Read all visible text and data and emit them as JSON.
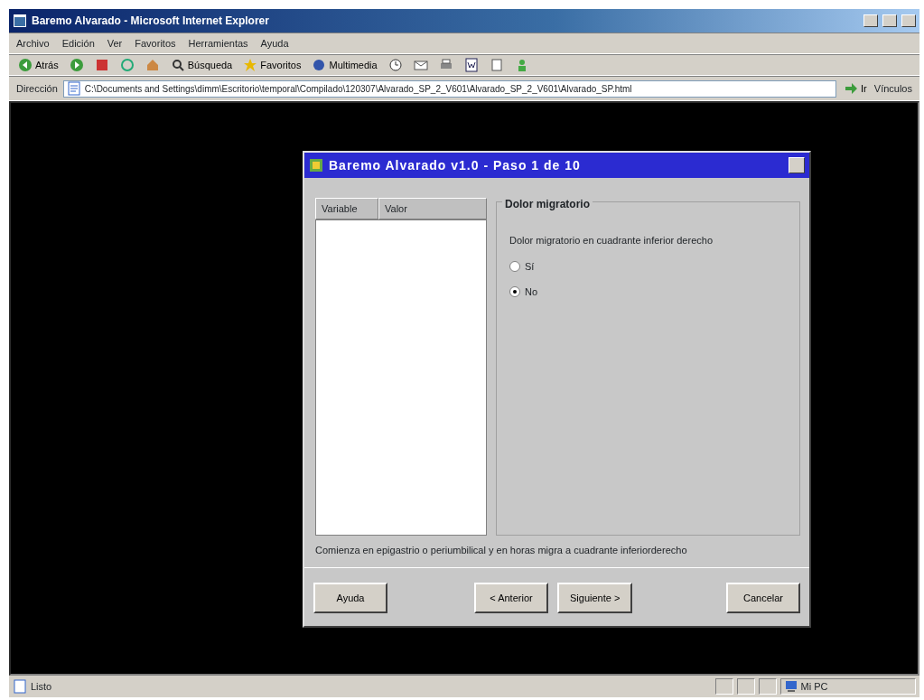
{
  "window": {
    "title": "Baremo Alvarado - Microsoft Internet Explorer"
  },
  "menu": [
    "Archivo",
    "Edición",
    "Ver",
    "Favoritos",
    "Herramientas",
    "Ayuda"
  ],
  "toolbar": [
    {
      "kind": "back",
      "label": "Atrás"
    },
    {
      "kind": "forward"
    },
    {
      "kind": "stop"
    },
    {
      "kind": "refresh"
    },
    {
      "kind": "home"
    },
    {
      "kind": "search",
      "label": "Búsqueda"
    },
    {
      "kind": "favorites",
      "label": "Favoritos"
    },
    {
      "kind": "media",
      "label": "Multimedia"
    },
    {
      "kind": "history"
    },
    {
      "kind": "mail"
    },
    {
      "kind": "print"
    },
    {
      "kind": "word"
    },
    {
      "kind": "edit"
    },
    {
      "kind": "messenger"
    }
  ],
  "address": {
    "label": "Dirección",
    "value": "C:\\Documents and Settings\\dimm\\Escritorio\\temporal\\Compilado\\120307\\Alvarado_SP_2_V601\\Alvarado_SP_2_V601\\Alvarado_SP.html",
    "go": "Ir",
    "links": "Vínculos"
  },
  "dialog": {
    "title": "Baremo Alvarado v1.0 - Paso 1 de 10",
    "table": {
      "columns": [
        "Variable",
        "Valor"
      ]
    },
    "group": {
      "title": "Dolor migratorio",
      "question": "Dolor migratorio en cuadrante inferior derecho",
      "options": [
        {
          "label": "Sí",
          "selected": false
        },
        {
          "label": "No",
          "selected": true
        }
      ]
    },
    "hint": "Comienza en epigastrio o periumbilical y en horas migra a cuadrante inferiorderecho",
    "buttons": [
      "Ayuda",
      "< Anterior",
      "Siguiente >",
      "Cancelar"
    ]
  },
  "status_bar": {
    "text": "Listo",
    "zone": "Mi PC"
  }
}
